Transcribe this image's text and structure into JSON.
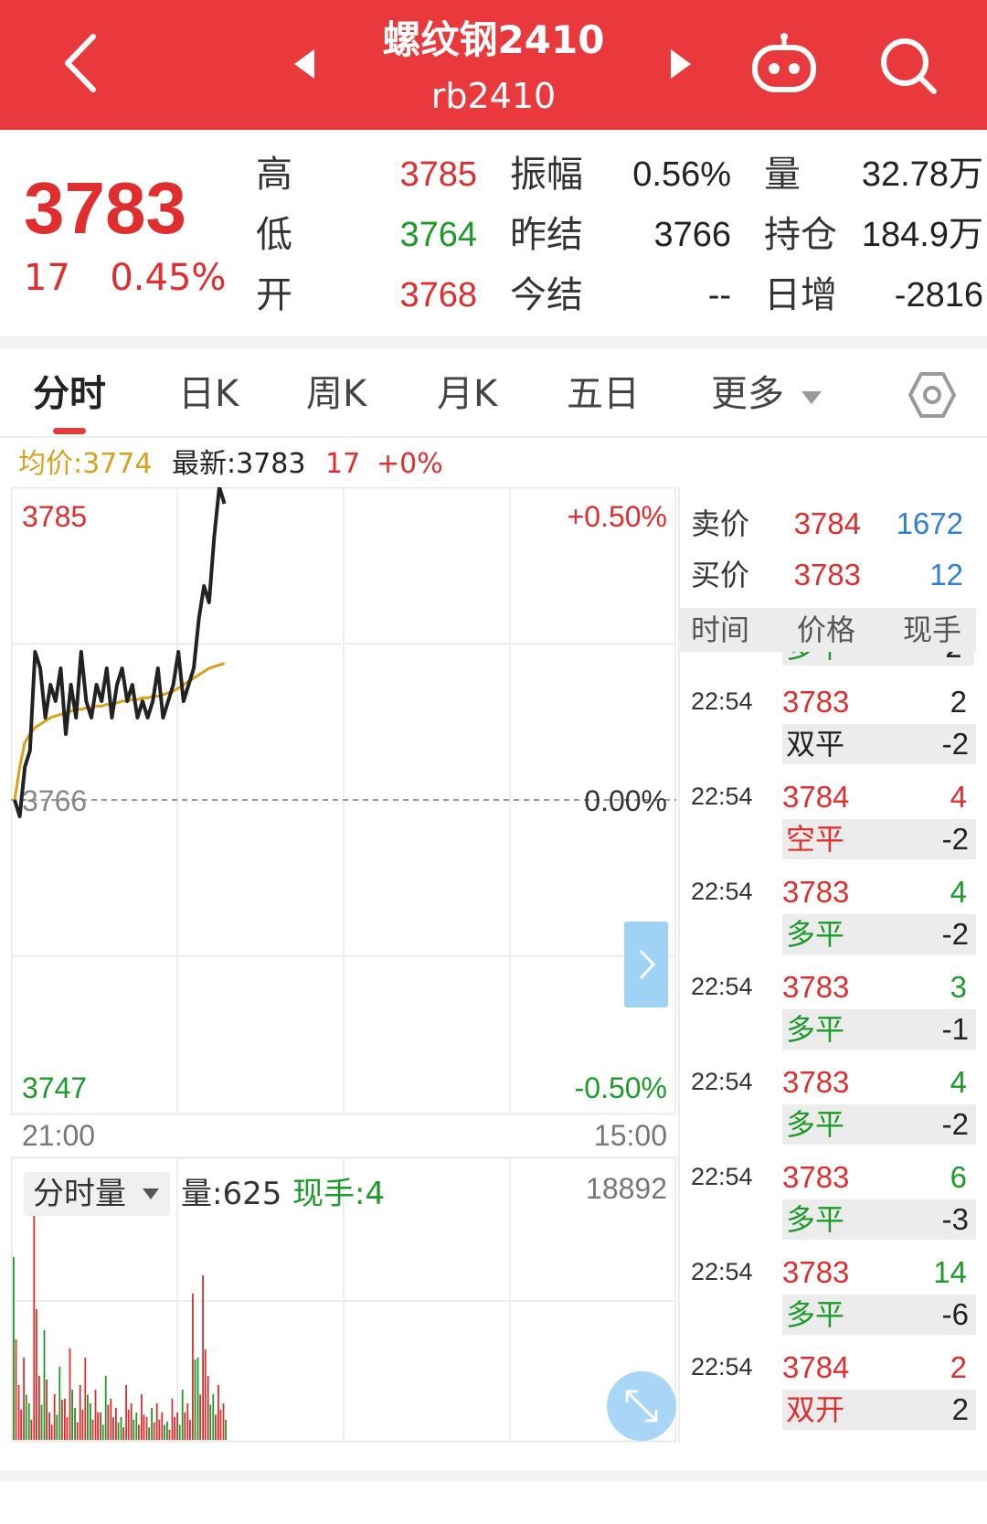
{
  "header": {
    "title": "螺纹钢2410",
    "code": "rb2410"
  },
  "quote": {
    "price": "3783",
    "change": "17",
    "change_pct": "0.45%",
    "high_label": "高",
    "high": "3785",
    "low_label": "低",
    "low": "3764",
    "open_label": "开",
    "open": "3768",
    "amp_label": "振幅",
    "amp": "0.56%",
    "prev_settle_label": "昨结",
    "prev_settle": "3766",
    "settle_label": "今结",
    "settle": "--",
    "vol_label": "量",
    "vol": "32.78万",
    "oi_label": "持仓",
    "oi": "184.9万",
    "oi_chg_label": "日增",
    "oi_chg": "-2816"
  },
  "tabs": [
    {
      "label": "分时"
    },
    {
      "label": "日K"
    },
    {
      "label": "周K"
    },
    {
      "label": "月K"
    },
    {
      "label": "五日"
    },
    {
      "label": "更多"
    }
  ],
  "info": {
    "avg_label": "均价:3774",
    "latest_label": "最新:3783",
    "chg": "17",
    "pct": "+0%"
  },
  "chart": {
    "y_high": "3785",
    "y_high_pct": "+0.50%",
    "y_mid": "3766",
    "y_mid_pct": "0.00%",
    "y_low": "3747",
    "y_low_pct": "-0.50%",
    "x_start": "21:00",
    "x_end": "15:00",
    "vol_label": "分时量",
    "vol_info": "量:625",
    "hand_info": "现手:4",
    "vol_max": "18892"
  },
  "chart_data": {
    "type": "line",
    "x_range": [
      "21:00",
      "15:00"
    ],
    "ylim": [
      3747,
      3785
    ],
    "series": [
      {
        "values": [
          3766,
          3765,
          3768,
          3769,
          3775,
          3774,
          3771,
          3773,
          3772,
          3774,
          3770,
          3773,
          3771,
          3775,
          3772,
          3771,
          3773,
          3772,
          3774,
          3771,
          3773,
          3774,
          3772,
          3773,
          3771,
          3772,
          3771,
          3772,
          3774,
          3771,
          3772,
          3773,
          3775,
          3772,
          3773,
          3774,
          3777,
          3779,
          3778,
          3782,
          3785,
          3784
        ]
      },
      {
        "values": [
          3766,
          3768,
          3769.5,
          3770,
          3770.4,
          3770.6,
          3770.8,
          3771,
          3771.1,
          3771.2,
          3771.3,
          3771.4,
          3771.5,
          3771.5,
          3771.6,
          3771.6,
          3771.7,
          3771.7,
          3771.8,
          3771.8,
          3771.9,
          3772,
          3772,
          3772.1,
          3772.1,
          3772.2,
          3772.2,
          3772.3,
          3772.3,
          3772.4,
          3772.5,
          3772.6,
          3772.8,
          3773,
          3773.2,
          3773.4,
          3773.6,
          3773.8,
          3774,
          3774.1,
          3774.2,
          3774.3
        ]
      }
    ],
    "volume": {
      "max": 18892
    }
  },
  "orderbook": {
    "ask_label": "卖价",
    "ask": "3784",
    "ask_vol": "1672",
    "bid_label": "买价",
    "bid": "3783",
    "bid_vol": "12"
  },
  "ticks_header": {
    "time": "时间",
    "price": "价格",
    "hand": "现手"
  },
  "ticks": [
    {
      "time": "22:54",
      "price": "3783",
      "vol": "2",
      "type": "双平",
      "chg": "-2",
      "price_color": "#e02e2e",
      "vol_color": "#222",
      "type_color": "#222"
    },
    {
      "time": "22:54",
      "price": "3784",
      "vol": "4",
      "type": "空平",
      "chg": "-2",
      "price_color": "#e02e2e",
      "vol_color": "#e02e2e",
      "type_color": "#e02e2e"
    },
    {
      "time": "22:54",
      "price": "3783",
      "vol": "4",
      "type": "多平",
      "chg": "-2",
      "price_color": "#e02e2e",
      "vol_color": "#1c9b2a",
      "type_color": "#1c9b2a"
    },
    {
      "time": "22:54",
      "price": "3783",
      "vol": "3",
      "type": "多平",
      "chg": "-1",
      "price_color": "#e02e2e",
      "vol_color": "#1c9b2a",
      "type_color": "#1c9b2a"
    },
    {
      "time": "22:54",
      "price": "3783",
      "vol": "4",
      "type": "多平",
      "chg": "-2",
      "price_color": "#e02e2e",
      "vol_color": "#1c9b2a",
      "type_color": "#1c9b2a"
    },
    {
      "time": "22:54",
      "price": "3783",
      "vol": "6",
      "type": "多平",
      "chg": "-3",
      "price_color": "#e02e2e",
      "vol_color": "#1c9b2a",
      "type_color": "#1c9b2a"
    },
    {
      "time": "22:54",
      "price": "3783",
      "vol": "14",
      "type": "多平",
      "chg": "-6",
      "price_color": "#e02e2e",
      "vol_color": "#1c9b2a",
      "type_color": "#1c9b2a"
    },
    {
      "time": "22:54",
      "price": "3784",
      "vol": "2",
      "type": "双开",
      "chg": "2",
      "price_color": "#e02e2e",
      "vol_color": "#e02e2e",
      "type_color": "#e02e2e"
    }
  ],
  "ticks_partial": {
    "type": "多平",
    "chg": "-2"
  },
  "colors": {
    "up": "#e02e2e",
    "down": "#1c9b2a",
    "accent": "#e9393d",
    "avg_line": "#d7a21b",
    "price_line": "#222222"
  }
}
